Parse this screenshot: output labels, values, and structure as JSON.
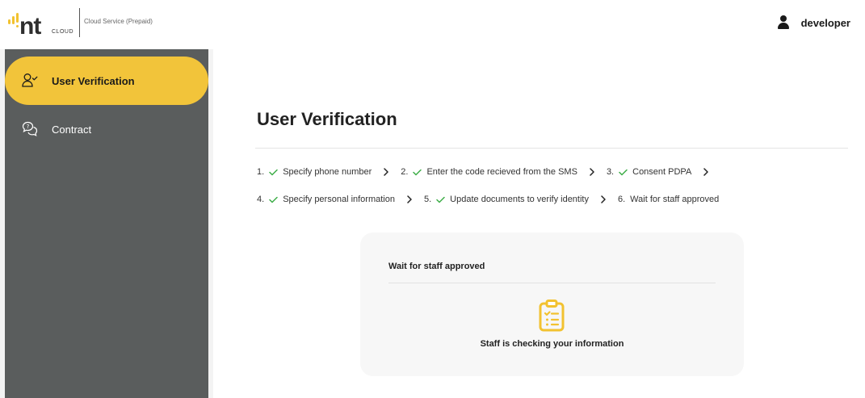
{
  "header": {
    "logo_text": "nt",
    "logo_suffix": "CLOUD",
    "service_name": "Cloud Service (Prepaid)",
    "username": "developer"
  },
  "sidebar": {
    "items": [
      {
        "label": "User Verification",
        "icon": "user-check-icon",
        "active": true
      },
      {
        "label": "Contract",
        "icon": "chat-bubbles-icon",
        "active": false
      }
    ]
  },
  "main": {
    "title": "User Verification",
    "steps_row1": [
      {
        "num": "1.",
        "label": "Specify phone number",
        "done": true
      },
      {
        "num": "2.",
        "label": "Enter the code recieved from the SMS",
        "done": true
      },
      {
        "num": "3.",
        "label": "Consent PDPA",
        "done": true
      }
    ],
    "steps_row2": [
      {
        "num": "4.",
        "label": "Specify personal information",
        "done": true
      },
      {
        "num": "5.",
        "label": "Update documents to verify identity",
        "done": true
      },
      {
        "num": "6.",
        "label": "Wait for staff approved",
        "done": false
      }
    ],
    "card": {
      "title": "Wait for staff approved",
      "icon": "clipboard-checklist-icon",
      "message": "Staff is checking your information"
    }
  },
  "colors": {
    "accent": "#f2c43a",
    "sidebar_bg": "#5a5d5d",
    "check_green": "#3fae49"
  }
}
